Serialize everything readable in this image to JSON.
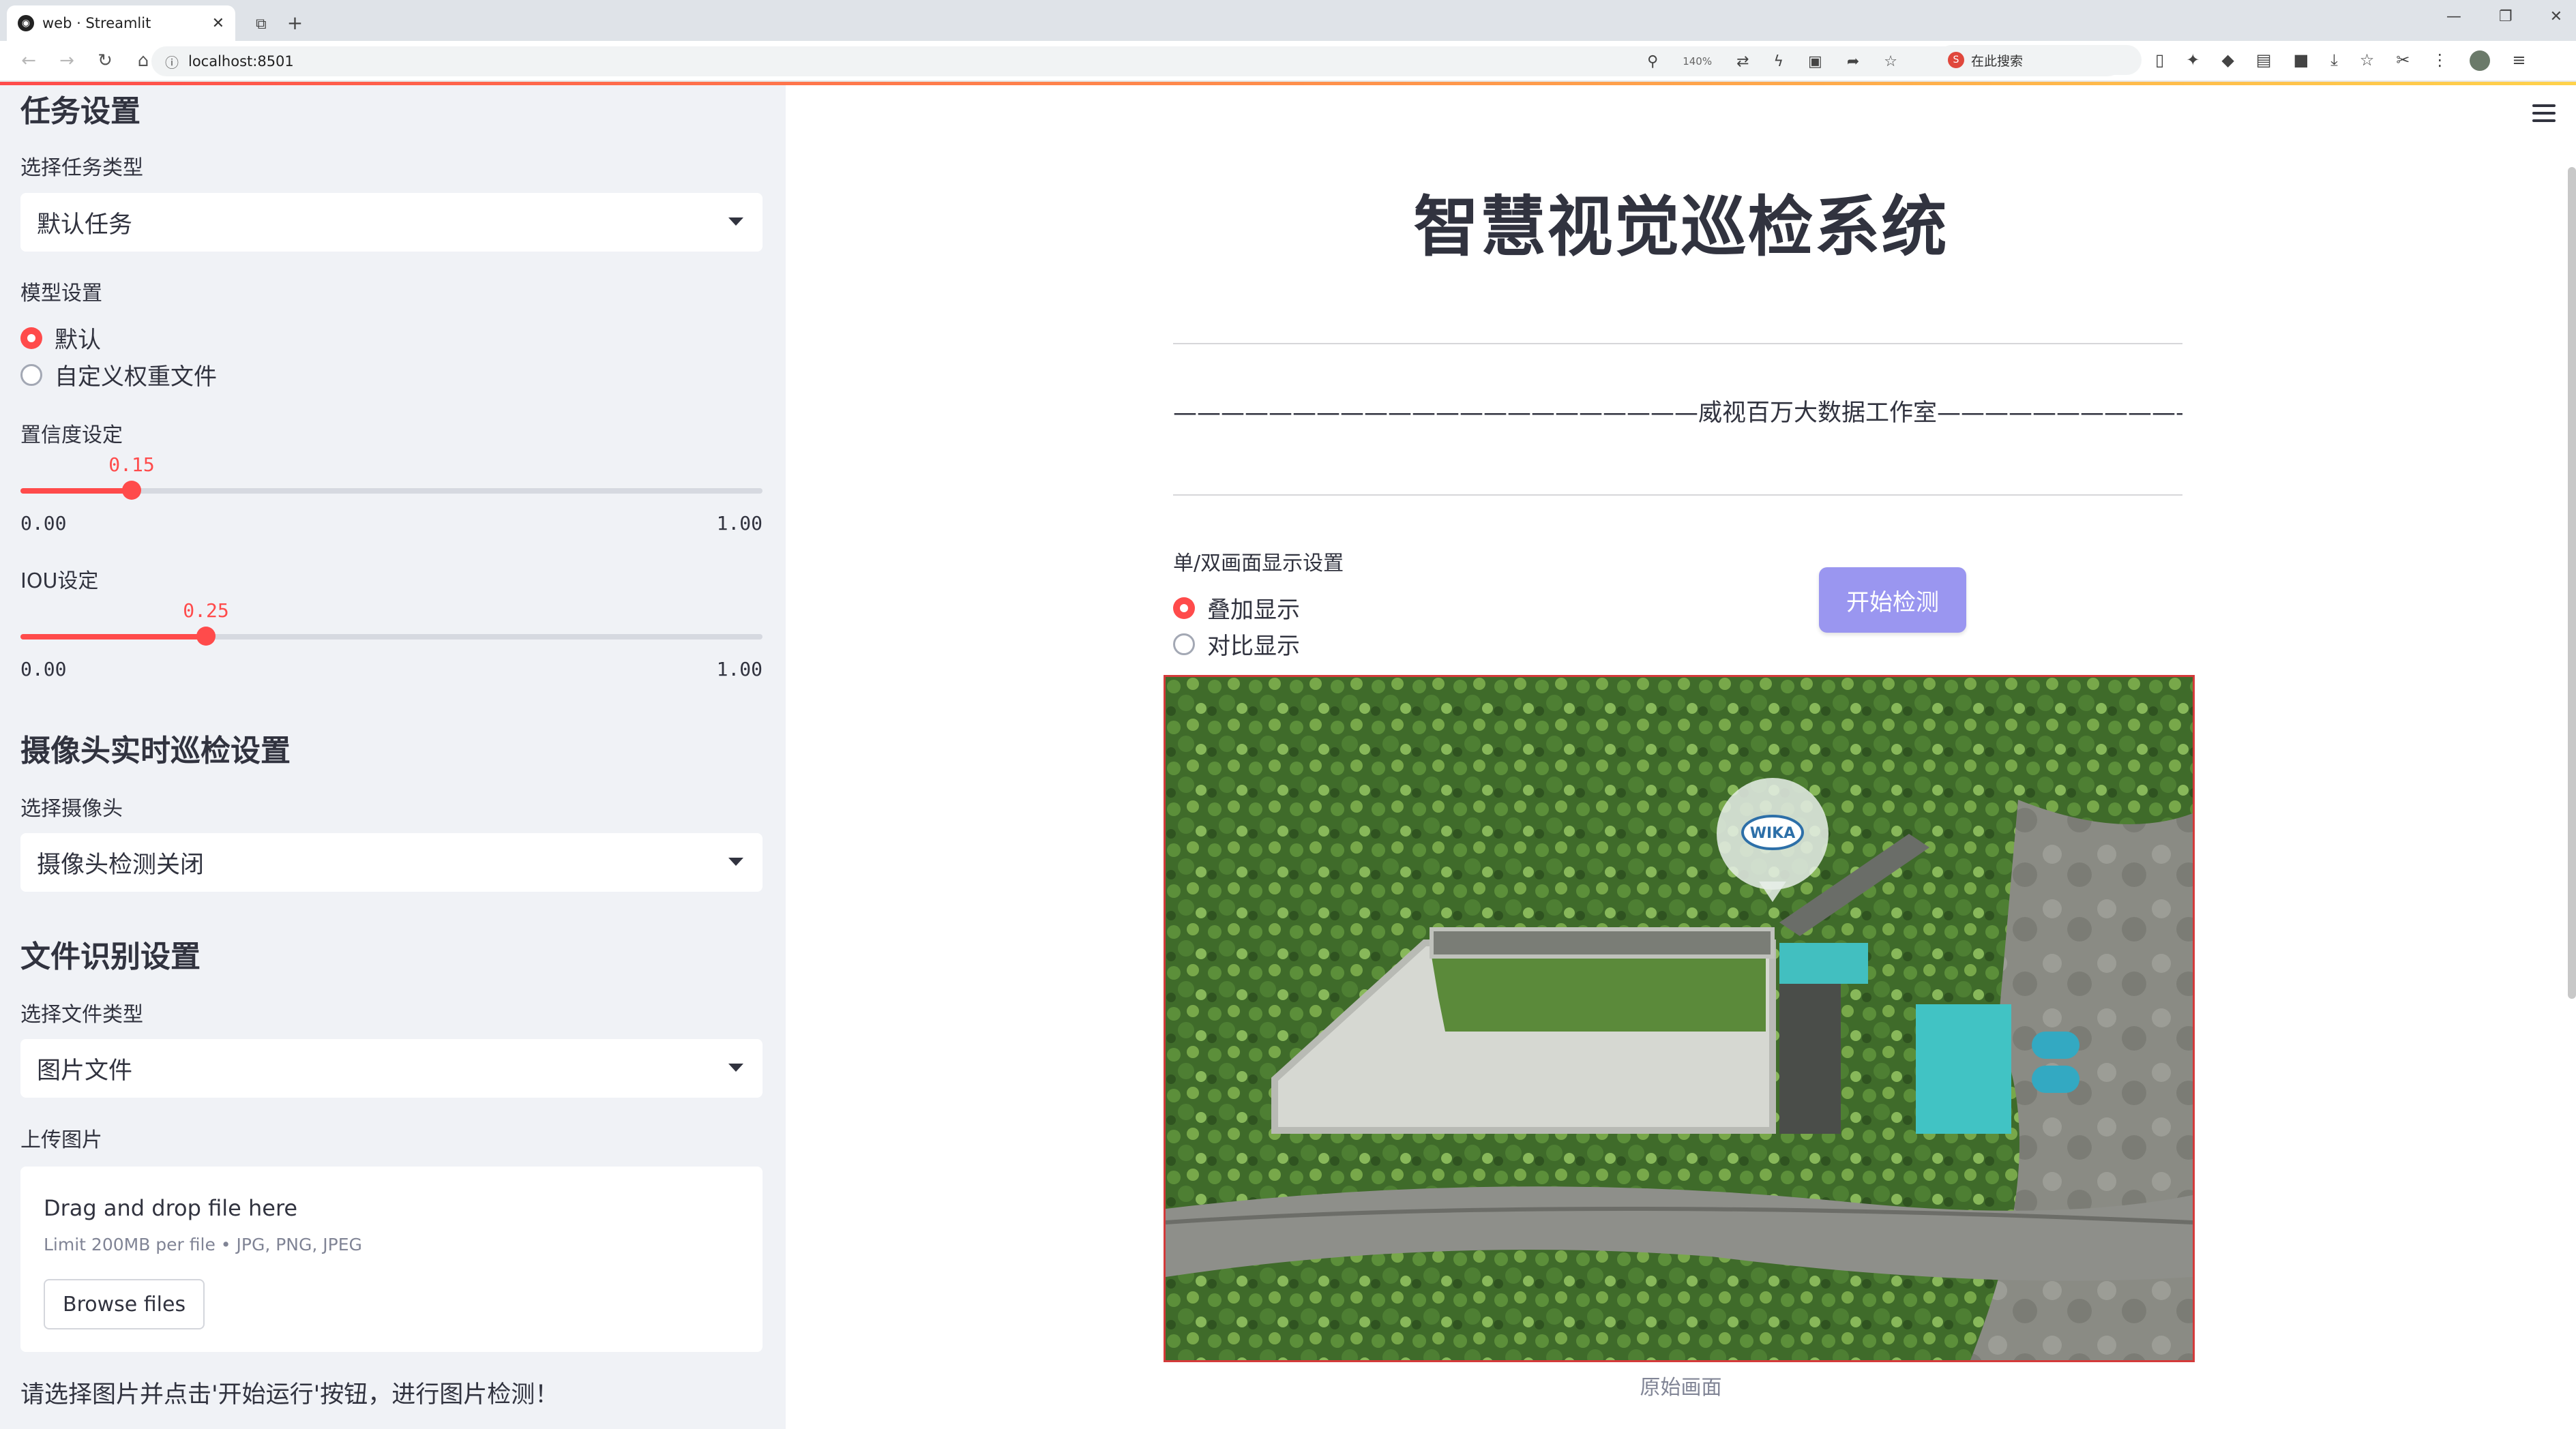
{
  "browser": {
    "tab_title": "web · Streamlit",
    "tab_close": "✕",
    "url": "localhost:8501",
    "zoom": "140%",
    "search_label": "在此搜索"
  },
  "sidebar": {
    "task_section_title": "任务设置",
    "task_type_label": "选择任务类型",
    "task_type_value": "默认任务",
    "model_label": "模型设置",
    "model_options": [
      "默认",
      "自定义权重文件"
    ],
    "model_selected": 0,
    "confidence_label": "置信度设定",
    "confidence": {
      "value": "0.15",
      "min": "0.00",
      "max": "1.00",
      "fraction": 0.15
    },
    "iou_label": "IOU设定",
    "iou": {
      "value": "0.25",
      "min": "0.00",
      "max": "1.00",
      "fraction": 0.25
    },
    "camera_section_title": "摄像头实时巡检设置",
    "camera_label": "选择摄像头",
    "camera_value": "摄像头检测关闭",
    "file_section_title": "文件识别设置",
    "file_type_label": "选择文件类型",
    "file_type_value": "图片文件",
    "upload_label": "上传图片",
    "upload_title": "Drag and drop file here",
    "upload_limit": "Limit 200MB per file • JPG, PNG, JPEG",
    "browse_button": "Browse files",
    "note": "请选择图片并点击'开始运行'按钮，进行图片检测！"
  },
  "main": {
    "title": "智慧视觉巡检系统",
    "studio_line": "——————————————————————威视百万大数据工作室————————————————————————",
    "display_label": "单/双画面显示设置",
    "display_options": [
      "叠加显示",
      "对比显示"
    ],
    "display_selected": 0,
    "run_button": "开始检测",
    "photo_badge": "WIKA",
    "caption": "原始画面"
  },
  "colors": {
    "accent": "#ff4b4b",
    "button": "#9a96f0",
    "sidebar_bg": "#f0f2f6"
  }
}
